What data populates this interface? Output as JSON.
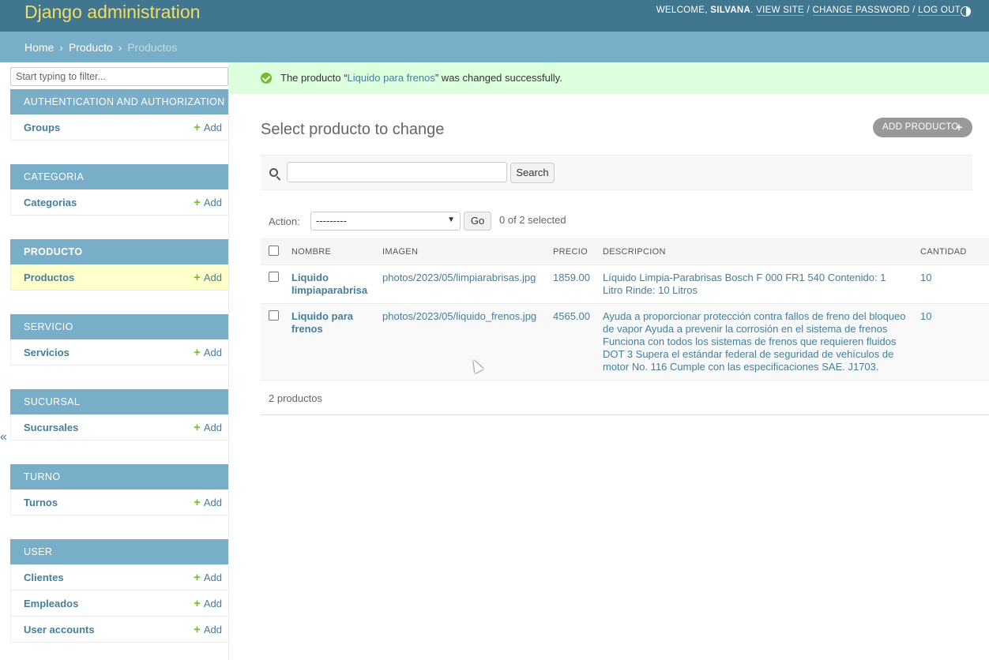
{
  "header": {
    "brand": "Django administration",
    "welcome": "WELCOME,",
    "user": "SILVANA",
    "links": [
      "VIEW SITE",
      "CHANGE PASSWORD",
      "LOG OUT"
    ],
    "sep": "/"
  },
  "breadcrumbs": {
    "home": "Home",
    "app": "Producto",
    "current": "Productos",
    "sep": "›"
  },
  "sidebar": {
    "filter_placeholder": "Start typing to filter...",
    "add_label": "Add",
    "toggle": "«",
    "modules": [
      {
        "caption": "Authentication and Authorization",
        "models": [
          "Groups"
        ]
      },
      {
        "caption": "Categoria",
        "models": [
          "Categorias"
        ]
      },
      {
        "caption": "Producto",
        "models": [
          "Productos"
        ]
      },
      {
        "caption": "Servicio",
        "models": [
          "Servicios"
        ]
      },
      {
        "caption": "Sucursal",
        "models": [
          "Sucursales"
        ]
      },
      {
        "caption": "Turno",
        "models": [
          "Turnos"
        ]
      },
      {
        "caption": "User",
        "models": [
          "Clientes",
          "Empleados",
          "User accounts"
        ]
      }
    ]
  },
  "message": {
    "prefix": "The producto “",
    "link": "Liquido para frenos",
    "suffix": "” was changed successfully."
  },
  "main": {
    "title": "Select producto to change",
    "add_button": "ADD PRODUCTO",
    "search_button": "Search",
    "search_value": "",
    "action_label": "Action:",
    "action_selected": "---------",
    "go_button": "Go",
    "counter": "0 of 2 selected",
    "columns": [
      "NOMBRE",
      "IMAGEN",
      "PRECIO",
      "DESCRIPCION",
      "CANTIDAD"
    ],
    "rows": [
      {
        "nombre": "Liquido limpiaparabrisa",
        "imagen": "photos/2023/05/limpiarabrisas.jpg",
        "precio": "1859.00",
        "descripcion": "Líquido Limpia-Parabrisas Bosch F 000 FR1 540 Contenido: 1 Litro Rinde: 10 Litros",
        "cantidad": "10"
      },
      {
        "nombre": "Liquido para frenos",
        "imagen": "photos/2023/05/liquido_frenos.jpg",
        "precio": "4565.00",
        "descripcion": "Ayuda a proporcionar protección contra fallos de freno del bloqueo de vapor Ayuda a prevenir la corrosión en el sistema de frenos Funciona con todos los sistemas de frenos que requieren fluidos DOT 3 Supera el estándar federal de seguridad de vehículos de motor No. 116 Cumple con las especificaciones SAE. J1703.",
        "cantidad": "10"
      }
    ],
    "paginator": "2 productos"
  },
  "colors": {
    "header_bg": "#417690",
    "brand": "#f5dd5d",
    "breadcrumbs_bg": "#79aec8",
    "link": "#447e9b",
    "add_green": "#70bf2b",
    "success_bg": "#dfd",
    "current_row": "#ffffcc"
  },
  "icons": [
    "theme-toggle-icon",
    "success-check-icon",
    "search-icon",
    "add-plus-icon",
    "mouse-cursor-icon"
  ]
}
